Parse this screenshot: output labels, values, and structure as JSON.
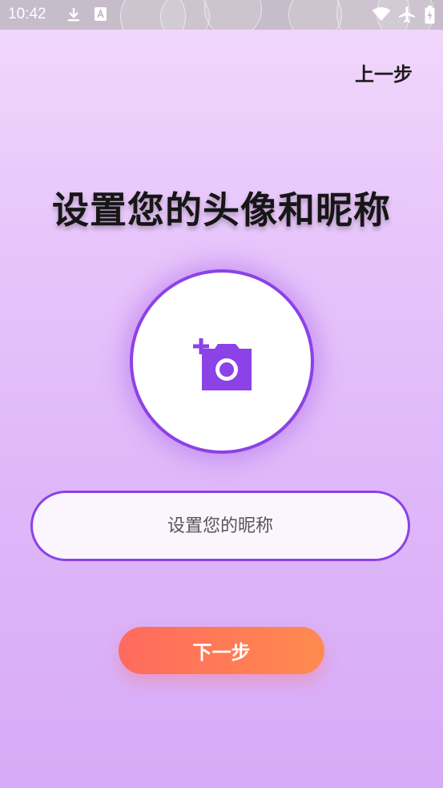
{
  "status_bar": {
    "time": "10:42",
    "icons": [
      "download-icon",
      "font-icon",
      "wifi-icon",
      "airplane-mode-icon",
      "battery-charging-icon"
    ]
  },
  "header": {
    "back_label": "上一步"
  },
  "main": {
    "title": "设置您的头像和昵称",
    "avatar_icon": "add-photo-icon",
    "nickname_placeholder": "设置您的昵称",
    "nickname_value": "",
    "next_label": "下一步"
  },
  "colors": {
    "accent": "#8b42e6",
    "button_start": "#ff6a5e",
    "button_end": "#ff8a4f",
    "background_top": "#f3d9fb",
    "background_bottom": "#d7aaf7"
  }
}
